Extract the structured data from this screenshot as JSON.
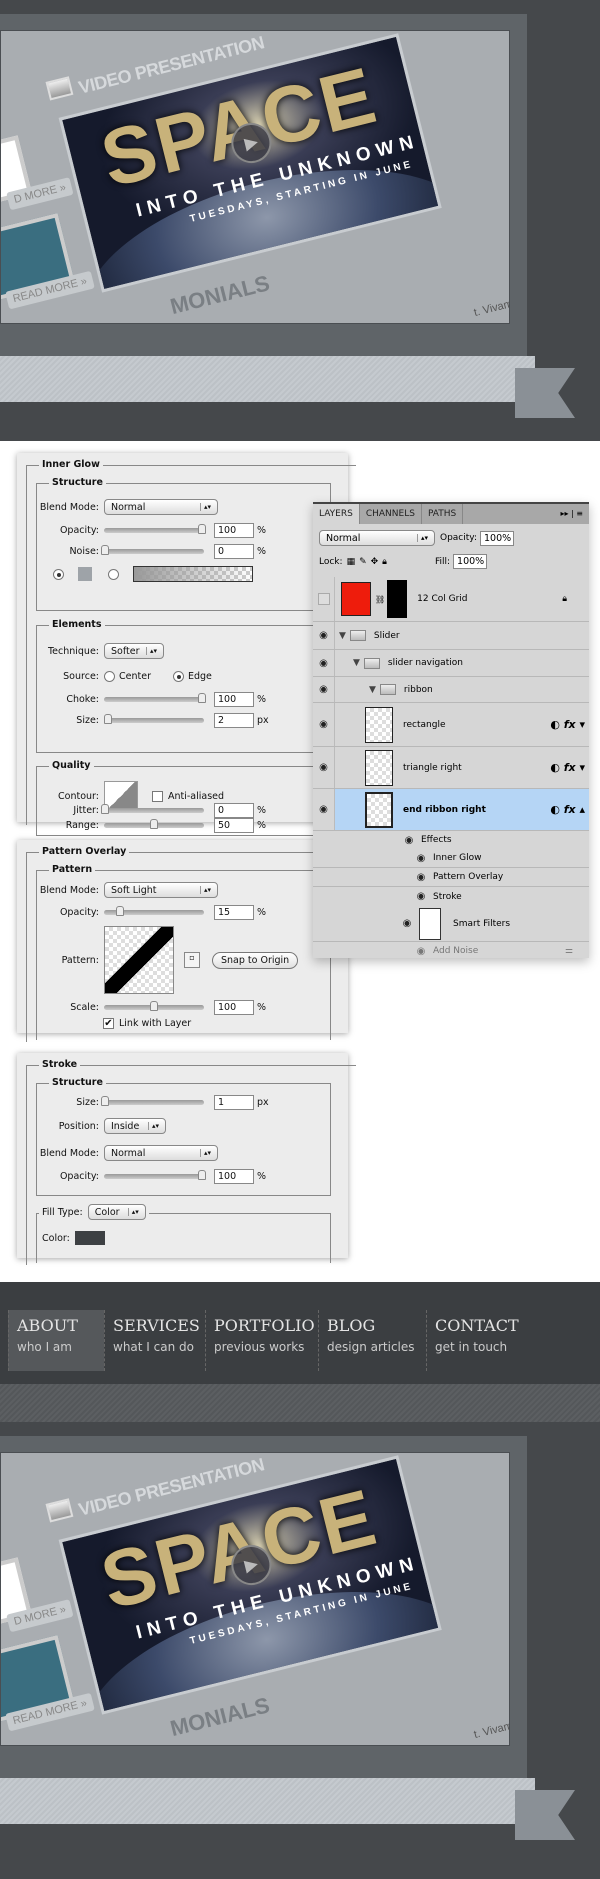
{
  "hero": {
    "section_title": "VIDEO PRESENTATION",
    "poster_title": "SPACE",
    "poster_tagline": "INTO THE UNKNOWN",
    "poster_subtitle": "TUESDAYS, STARTING IN JUNE",
    "read_more": "READ MORE »",
    "read_more_partial": "D MORE »",
    "testimonials": "MONIALS",
    "testimonial_snippet": "t. Vivamus qu"
  },
  "inner_glow": {
    "title": "Inner Glow",
    "structure": "Structure",
    "blend_mode_label": "Blend Mode:",
    "blend_mode": "Normal",
    "opacity_label": "Opacity:",
    "opacity": "100",
    "noise_label": "Noise:",
    "noise": "0",
    "pct": "%",
    "px": "px",
    "elements": "Elements",
    "technique_label": "Technique:",
    "technique": "Softer",
    "source_label": "Source:",
    "source_center": "Center",
    "source_edge": "Edge",
    "choke_label": "Choke:",
    "choke": "100",
    "size_label": "Size:",
    "size": "2",
    "quality": "Quality",
    "contour_label": "Contour:",
    "anti_aliased": "Anti-aliased",
    "range_label": "Range:",
    "range": "50",
    "jitter_label": "Jitter:",
    "jitter": "0"
  },
  "pattern_overlay": {
    "title": "Pattern Overlay",
    "pattern_group": "Pattern",
    "blend_mode_label": "Blend Mode:",
    "blend_mode": "Soft Light",
    "opacity_label": "Opacity:",
    "opacity": "15",
    "pattern_label": "Pattern:",
    "snap": "Snap to Origin",
    "scale_label": "Scale:",
    "scale": "100",
    "link": "Link with Layer",
    "pct": "%"
  },
  "stroke": {
    "title": "Stroke",
    "structure": "Structure",
    "size_label": "Size:",
    "size": "1",
    "px": "px",
    "position_label": "Position:",
    "position": "Inside",
    "blend_mode_label": "Blend Mode:",
    "blend_mode": "Normal",
    "opacity_label": "Opacity:",
    "opacity": "100",
    "pct": "%",
    "fill_type_label": "Fill Type:",
    "fill_type": "Color",
    "color_label": "Color:",
    "color": "#3d4043"
  },
  "layers": {
    "tabs": [
      "LAYERS",
      "CHANNELS",
      "PATHS"
    ],
    "blend": "Normal",
    "opacity_label": "Opacity:",
    "opacity": "100%",
    "lock_label": "Lock:",
    "fill_label": "Fill:",
    "fill": "100%",
    "items": [
      {
        "name": "12 Col Grid"
      },
      {
        "name": "Slider"
      },
      {
        "name": "slider navigation"
      },
      {
        "name": "ribbon"
      },
      {
        "name": "rectangle"
      },
      {
        "name": "triangle right"
      },
      {
        "name": "end ribbon right"
      }
    ],
    "effects": "Effects",
    "effect_items": [
      "Inner Glow",
      "Pattern Overlay",
      "Stroke"
    ],
    "smart_filters": "Smart Filters",
    "add_noise": "Add Noise",
    "selected_color": "#b5d5f5",
    "grid_color": "#ee1c0c"
  },
  "nav": [
    {
      "title": "ABOUT",
      "sub": "who I am",
      "active": true
    },
    {
      "title": "SERVICES",
      "sub": "what I can do"
    },
    {
      "title": "PORTFOLIO",
      "sub": "previous works"
    },
    {
      "title": "BLOG",
      "sub": "design articles"
    },
    {
      "title": "CONTACT",
      "sub": "get in touch"
    }
  ]
}
